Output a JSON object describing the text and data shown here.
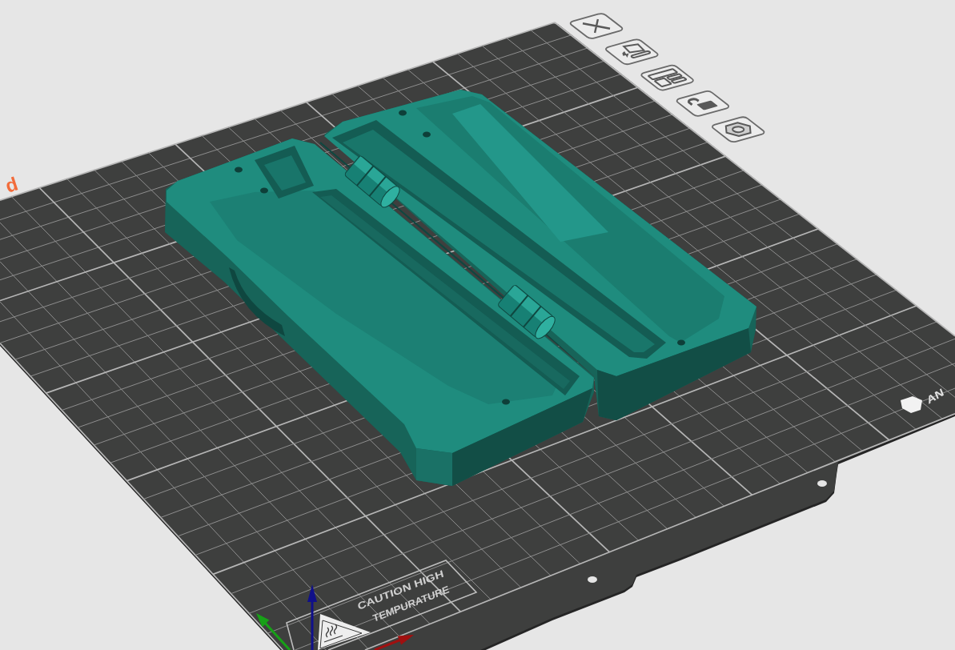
{
  "plate": {
    "label": "d",
    "brand": "AN",
    "warning_label": [
      "CAUTION HIGH",
      "TEMPURATURE"
    ]
  },
  "plate_toolbar": [
    {
      "kind": "delete"
    },
    {
      "kind": "orient"
    },
    {
      "kind": "arrange"
    },
    {
      "kind": "lock",
      "locked": false
    },
    {
      "kind": "settings"
    }
  ]
}
